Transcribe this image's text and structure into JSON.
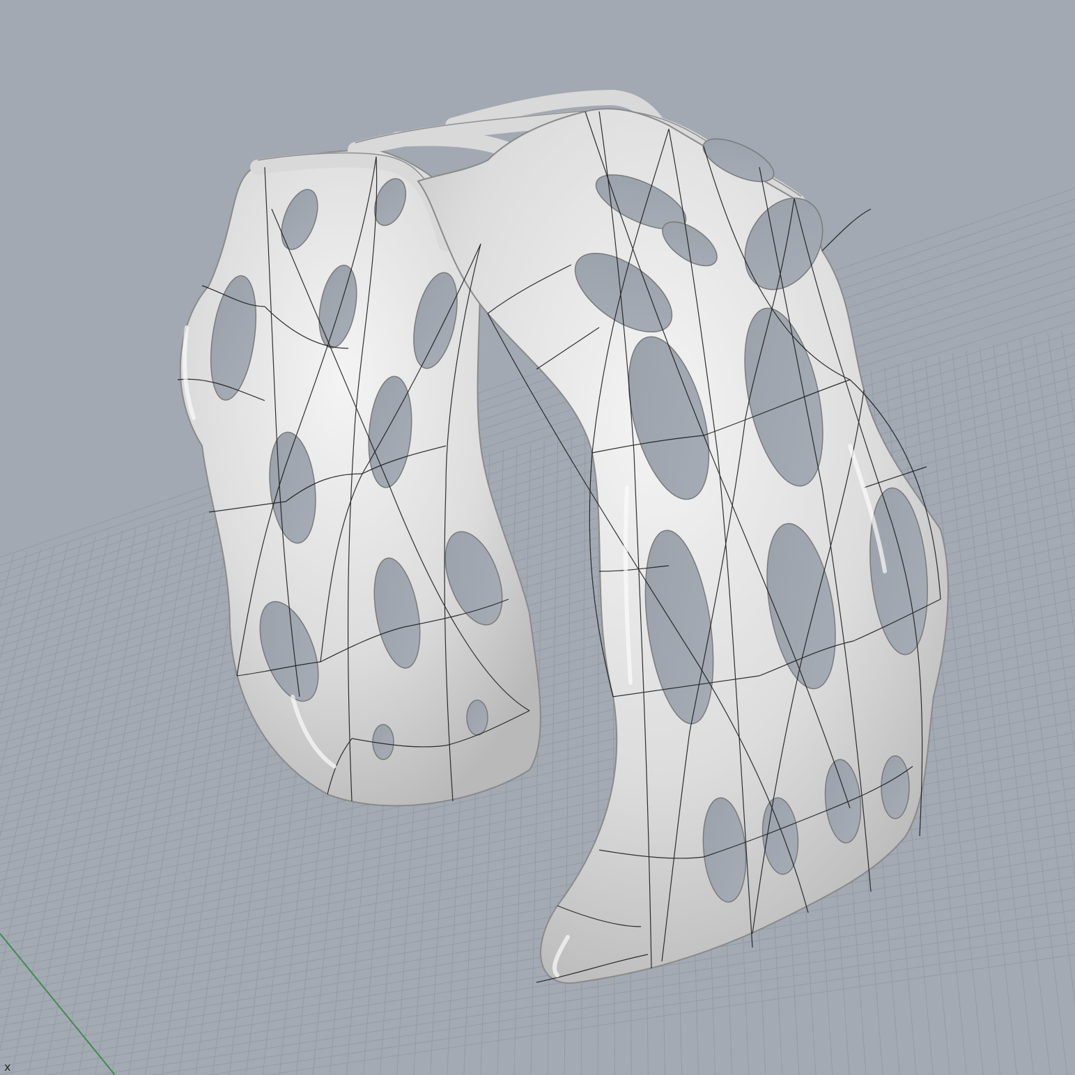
{
  "viewport": {
    "background_color": "#a2a9b2",
    "grid_color": "#8e96a0",
    "grid_major_color": "#838b96",
    "x_axis_color": "#b04444",
    "y_axis_color": "#3e8e4a",
    "axis_label": "x"
  },
  "model": {
    "type": "perforated-cuff-bracelet",
    "display_mode": "rendered-with-isocurves",
    "surface_color": "#e4e4e4",
    "isocurve_color": "#1a1a1a"
  }
}
